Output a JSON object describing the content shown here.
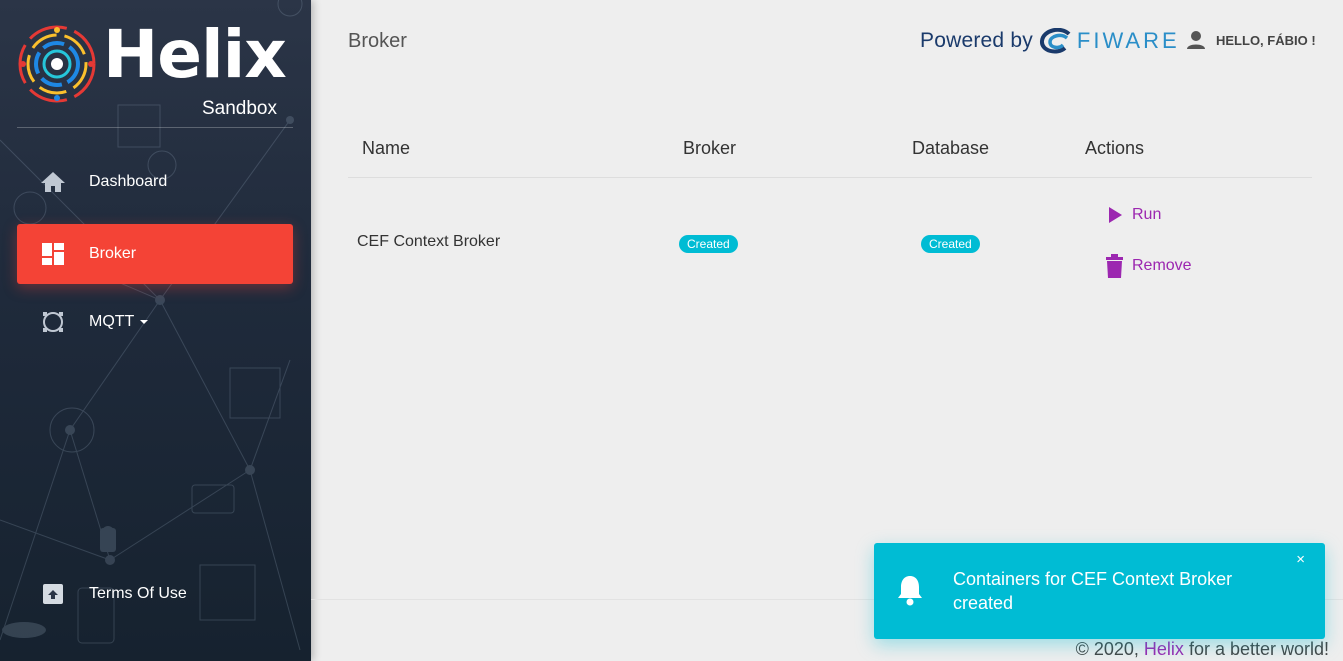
{
  "sidebar": {
    "logo_text": "Helix",
    "logo_subtitle": "Sandbox",
    "items": [
      {
        "label": "Dashboard",
        "icon": "home-icon",
        "active": false
      },
      {
        "label": "Broker",
        "icon": "dashboard-grid-icon",
        "active": true
      },
      {
        "label": "MQTT",
        "icon": "mqtt-circle-icon",
        "active": false,
        "dropdown": true
      },
      {
        "label": "Terms Of Use",
        "icon": "archive-box-icon",
        "active": false
      }
    ]
  },
  "header": {
    "title": "Broker",
    "powered_by": "Powered by",
    "powered_brand": "FIWARE",
    "user_greeting": "HELLO, FÁBIO !"
  },
  "table": {
    "columns": [
      "Name",
      "Broker",
      "Database",
      "Actions"
    ],
    "rows": [
      {
        "name": "CEF Context Broker",
        "broker_status": "Created",
        "database_status": "Created",
        "actions": [
          "Run",
          "Remove"
        ]
      }
    ]
  },
  "footer": {
    "copyright_prefix": "© 2020,",
    "brand": "Helix",
    "suffix": "for a better world!"
  },
  "notification": {
    "message": "Containers for CEF Context Broker created",
    "close": "×"
  },
  "colors": {
    "accent_red": "#f44336",
    "accent_purple": "#9c27b0",
    "badge_cyan": "#00bcd4",
    "sidebar_dark": "#1f2a3b"
  }
}
